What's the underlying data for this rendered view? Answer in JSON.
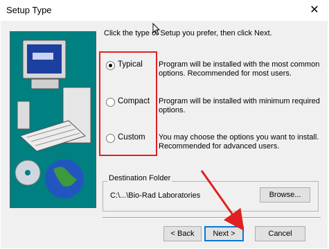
{
  "window": {
    "title": "Setup Type",
    "close_glyph": "✕"
  },
  "intro": "Click the type of Setup you prefer, then click Next.",
  "options": [
    {
      "label": "Typical",
      "selected": true,
      "description": "Program will be installed with the most common options. Recommended for most users."
    },
    {
      "label": "Compact",
      "selected": false,
      "description": "Program will be installed with minimum required options."
    },
    {
      "label": "Custom",
      "selected": false,
      "description": "You may choose the options you want to install. Recommended for advanced users."
    }
  ],
  "destination": {
    "legend": "Destination Folder",
    "path": "C:\\...\\Bio-Rad Laboratories",
    "browse_label": "Browse..."
  },
  "buttons": {
    "back": "< Back",
    "next": "Next >",
    "cancel": "Cancel"
  },
  "colors": {
    "side_panel": "#008080",
    "highlight": "#e02020",
    "accent": "#0078d7"
  }
}
